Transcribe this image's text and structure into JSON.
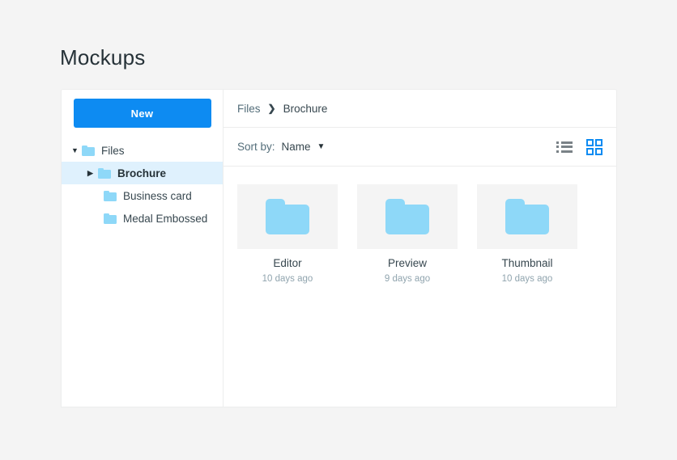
{
  "page": {
    "title": "Mockups",
    "background_color": "#f4f4f4"
  },
  "theme": {
    "accent": "#0d8bf2",
    "folder_blue": "#8ed8f8",
    "selected_row": "#dff1fd",
    "border": "#eceded",
    "text_primary": "#37474f",
    "text_muted": "#90a4ae"
  },
  "sidebar": {
    "new_button_label": "New",
    "tree": [
      {
        "label": "Files",
        "level": 1,
        "caret": "▼",
        "expanded": true,
        "selected": false,
        "icon": "folder-icon"
      },
      {
        "label": "Brochure",
        "level": 2,
        "caret": "▶",
        "expanded": false,
        "selected": true,
        "icon": "folder-icon"
      },
      {
        "label": "Business card",
        "level": 2,
        "caret": "",
        "expanded": false,
        "selected": false,
        "icon": "folder-icon"
      },
      {
        "label": "Medal Embossed",
        "level": 2,
        "caret": "",
        "expanded": false,
        "selected": false,
        "icon": "folder-icon"
      }
    ]
  },
  "breadcrumb": {
    "separator": "❯",
    "items": [
      {
        "label": "Files",
        "current": false
      },
      {
        "label": "Brochure",
        "current": true
      }
    ]
  },
  "toolbar": {
    "sort_label": "Sort by:",
    "sort_value": "Name",
    "sort_caret": "▼",
    "sort_options": [
      "Name"
    ],
    "views": [
      {
        "name": "list-view-icon",
        "active": false
      },
      {
        "name": "grid-view-icon",
        "active": true
      }
    ]
  },
  "files": [
    {
      "name": "Editor",
      "modified": "10 days ago",
      "icon": "folder-icon"
    },
    {
      "name": "Preview",
      "modified": "9 days ago",
      "icon": "folder-icon"
    },
    {
      "name": "Thumbnail",
      "modified": "10 days ago",
      "icon": "folder-icon"
    }
  ]
}
